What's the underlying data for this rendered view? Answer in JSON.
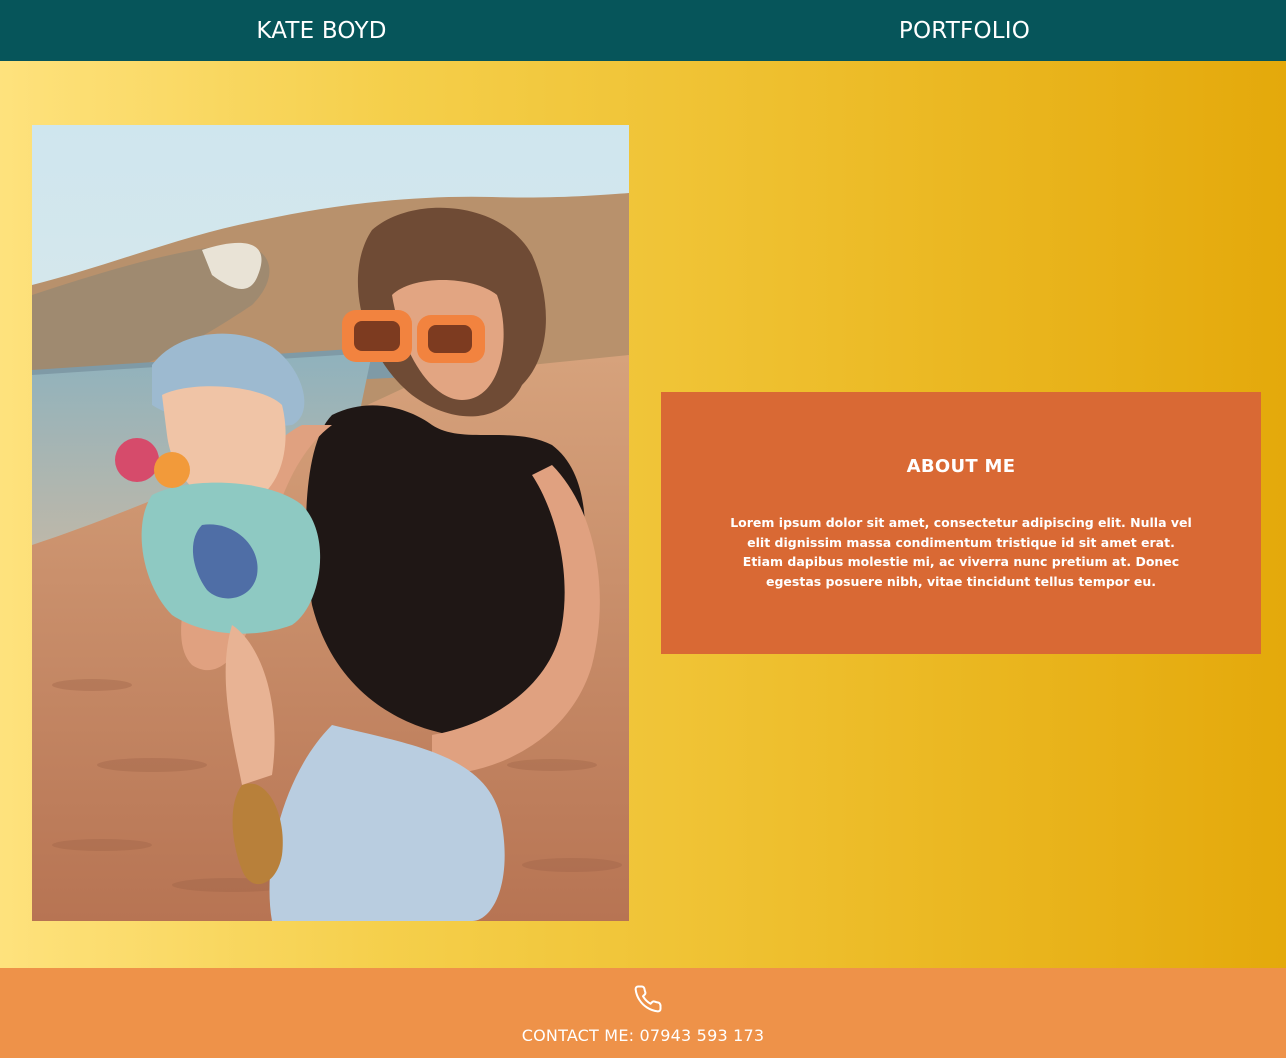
{
  "header": {
    "name": "KATE BOYD",
    "portfolio_link": "PORTFOLIO"
  },
  "hero": {
    "photo_icon": "photo-beach-mother-child"
  },
  "about": {
    "title": "ABOUT ME",
    "body": "Lorem ipsum dolor sit amet, consectetur adipiscing elit. Nulla vel elit dignissim massa condimentum tristique id sit amet erat. Etiam dapibus molestie mi, ac viverra nunc pretium at. Donec egestas posuere nibh, vitae tincidunt tellus tempor eu."
  },
  "footer": {
    "icon": "phone-icon",
    "contact": "CONTACT ME: 07943 593 173"
  },
  "colors": {
    "header_bg": "#06555a",
    "card_bg": "#d96934",
    "footer_bg": "#ee9249",
    "gradient_start": "#fee27d",
    "gradient_end": "#e4a90b"
  }
}
